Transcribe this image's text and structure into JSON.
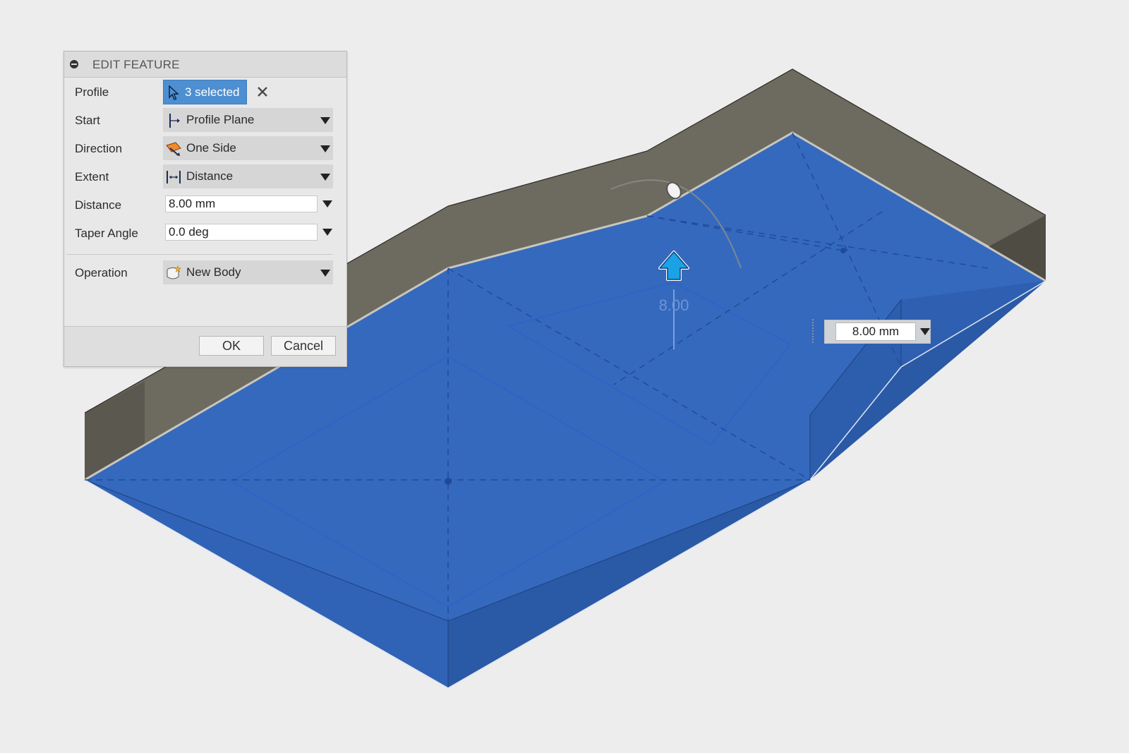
{
  "dialog": {
    "title": "EDIT FEATURE",
    "rows": {
      "profile": {
        "label": "Profile",
        "value": "3 selected"
      },
      "start": {
        "label": "Start",
        "value": "Profile Plane"
      },
      "direction": {
        "label": "Direction",
        "value": "One Side"
      },
      "extent": {
        "label": "Extent",
        "value": "Distance"
      },
      "distance": {
        "label": "Distance",
        "value": "8.00 mm"
      },
      "taper": {
        "label": "Taper Angle",
        "value": "0.0 deg"
      },
      "operation": {
        "label": "Operation",
        "value": "New Body"
      }
    },
    "ok_label": "OK",
    "cancel_label": "Cancel"
  },
  "viewport": {
    "dimension_label": "8.00",
    "distance_input": "8.00 mm",
    "arrow_icon": "extrude-arrow-icon",
    "colors": {
      "profile": "#3366bb",
      "body": "#6e6a5f",
      "accent": "#1aa1e6"
    }
  }
}
